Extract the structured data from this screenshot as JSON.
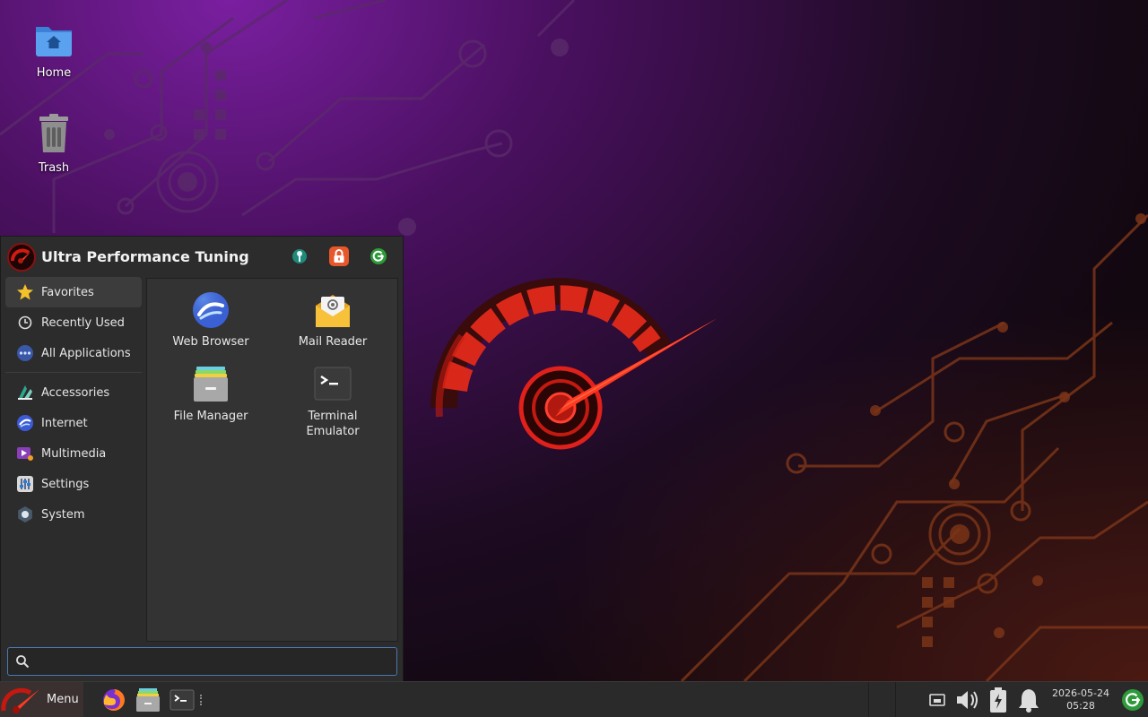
{
  "desktop": {
    "icons": [
      {
        "label": "Home"
      },
      {
        "label": "Trash"
      }
    ]
  },
  "menu": {
    "title": "Ultra Performance Tuning",
    "header_buttons": [
      "settings-manager",
      "lock-screen",
      "log-out"
    ],
    "categories": [
      {
        "label": "Favorites",
        "icon": "star-icon",
        "active": true
      },
      {
        "label": "Recently Used",
        "icon": "clock-icon"
      },
      {
        "label": "All Applications",
        "icon": "dots-icon"
      },
      {
        "label": "Accessories",
        "icon": "accessories-icon"
      },
      {
        "label": "Internet",
        "icon": "internet-icon"
      },
      {
        "label": "Multimedia",
        "icon": "multimedia-icon"
      },
      {
        "label": "Settings",
        "icon": "settings-icon"
      },
      {
        "label": "System",
        "icon": "system-icon"
      }
    ],
    "apps": [
      {
        "label": "Web Browser",
        "icon": "web-browser-icon"
      },
      {
        "label": "Mail Reader",
        "icon": "mail-reader-icon"
      },
      {
        "label": "File Manager",
        "icon": "file-manager-icon"
      },
      {
        "label": "Terminal\nEmulator",
        "line1": "Terminal",
        "line2": "Emulator",
        "icon": "terminal-icon"
      }
    ],
    "search": {
      "value": "",
      "placeholder": ""
    }
  },
  "taskbar": {
    "menu_label": "Menu",
    "launchers": [
      "firefox-icon",
      "file-manager-icon",
      "terminal-icon"
    ],
    "clock": {
      "date": "2026-05-24",
      "time": "05:28"
    }
  },
  "colors": {
    "accent_red": "#e0201a",
    "menu_bg": "#2c2c2c",
    "taskbar_bg": "#2a2a2a",
    "search_border": "#4a78b0"
  }
}
